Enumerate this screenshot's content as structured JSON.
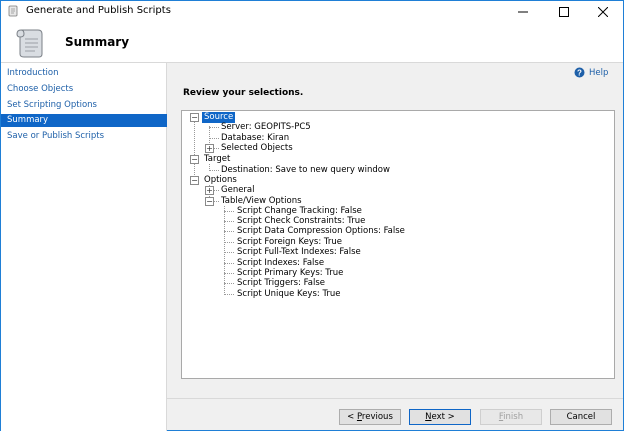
{
  "window": {
    "title": "Generate and Publish Scripts",
    "controls": {
      "minimize": "—",
      "maximize": "☐",
      "close": "✕"
    }
  },
  "header": {
    "title": "Summary"
  },
  "nav": {
    "items": [
      {
        "label": "Introduction"
      },
      {
        "label": "Choose Objects"
      },
      {
        "label": "Set Scripting Options"
      },
      {
        "label": "Summary"
      },
      {
        "label": "Save or Publish Scripts"
      }
    ]
  },
  "help": {
    "label": "Help"
  },
  "main": {
    "section_title": "Review your selections."
  },
  "tree": {
    "source": "Source",
    "server": "Server: GEOPITS-PC5",
    "database": "Database: Kiran",
    "selected_objects": "Selected Objects",
    "target": "Target",
    "destination": "Destination: Save to new query window",
    "options": "Options",
    "general": "General",
    "table_view_options": "Table/View Options",
    "opts": [
      "Script Change Tracking: False",
      "Script Check Constraints: True",
      "Script Data Compression Options: False",
      "Script Foreign Keys: True",
      "Script Full-Text Indexes: False",
      "Script Indexes: False",
      "Script Primary Keys: True",
      "Script Triggers: False",
      "Script Unique Keys: True"
    ],
    "expander_minus": "−",
    "expander_plus": "+"
  },
  "buttons": {
    "previous_prefix": "< ",
    "previous_hotkey": "P",
    "previous_rest": "revious",
    "next_hotkey": "N",
    "next_rest": "ext >",
    "finish_hotkey": "F",
    "finish_rest": "inish",
    "cancel": "Cancel"
  },
  "colors": {
    "accent": "#0f66c7",
    "link": "#1d5fa8",
    "window_border": "#1f7fd6"
  },
  "icons": {
    "app": "scroll-icon",
    "header": "scroll-icon",
    "help": "help-circle-icon"
  }
}
